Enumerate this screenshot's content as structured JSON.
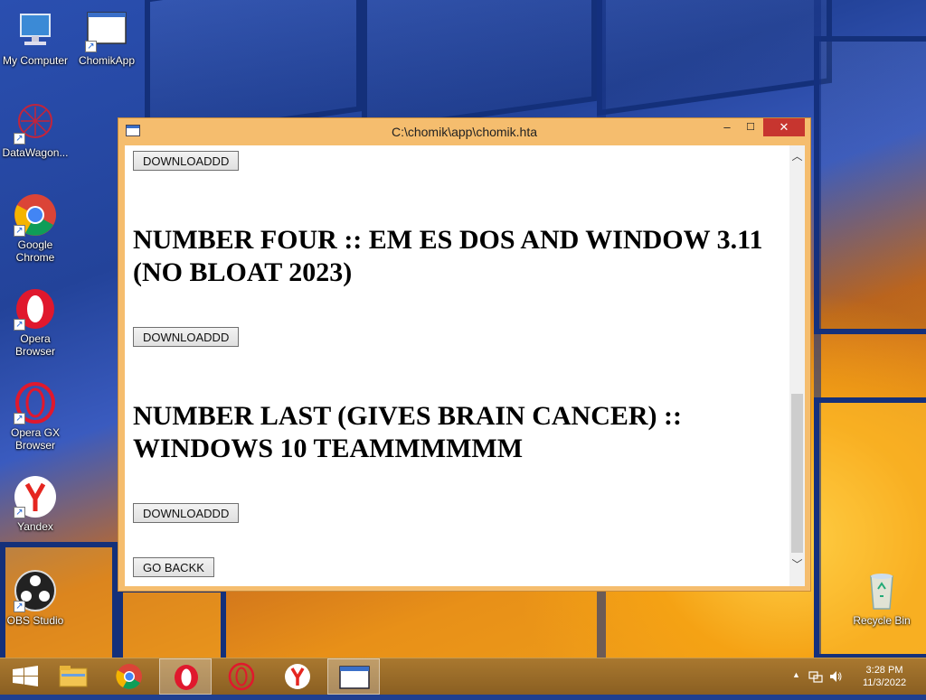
{
  "desktop": {
    "icons": [
      {
        "label": "My Computer"
      },
      {
        "label": "ChomikApp"
      },
      {
        "label": "DataWagon..."
      },
      {
        "label": "Google Chrome"
      },
      {
        "label": "Opera Browser"
      },
      {
        "label": "Opera GX Browser"
      },
      {
        "label": "Yandex"
      },
      {
        "label": "OBS Studio"
      },
      {
        "label": "Recycle Bin"
      }
    ]
  },
  "window": {
    "title": "C:\\chomik\\app\\chomik.hta",
    "minimize_glyph": "–",
    "maximize_glyph": "☐",
    "close_glyph": "✕",
    "content": {
      "download_label": "DOWNLOADDD",
      "heading_four": "NUMBER FOUR :: EM ES DOS AND WINDOW 3.11 (NO BLOAT 2023)",
      "heading_last": "NUMBER LAST (GIVES BRAIN CANCER) :: WINDOWS 10 TEAMMMMMM",
      "go_back_label": "GO BACKK"
    }
  },
  "taskbar": {
    "items": [
      {
        "icon": "start-icon"
      },
      {
        "icon": "file-explorer-icon"
      },
      {
        "icon": "chrome-icon"
      },
      {
        "icon": "opera-icon",
        "active": true
      },
      {
        "icon": "opera-gx-icon"
      },
      {
        "icon": "yandex-icon"
      },
      {
        "icon": "hta-window-icon",
        "active": true
      }
    ],
    "clock": {
      "time": "3:28 PM",
      "date": "11/3/2022"
    }
  },
  "colors": {
    "window_frame": "#f5bd6e",
    "close_button": "#c7352f",
    "taskbar": "#9a6a28"
  }
}
